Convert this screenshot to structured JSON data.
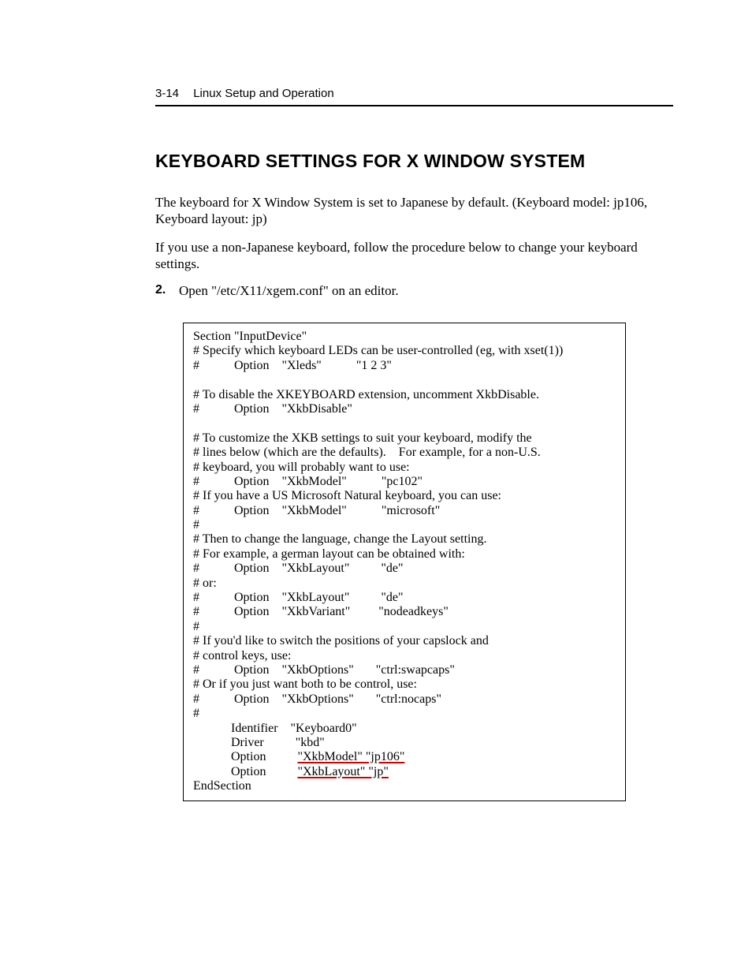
{
  "header": {
    "page_number": "3-14",
    "chapter_title": "Linux Setup and Operation"
  },
  "section_title": "KEYBOARD SETTINGS FOR X WINDOW SYSTEM",
  "paragraphs": {
    "p1": "The keyboard for X Window System is set to Japanese by default. (Keyboard model: jp106, Keyboard layout: jp)",
    "p2": "If you use a non-Japanese keyboard, follow the procedure below to change your keyboard settings."
  },
  "step": {
    "number": "2.",
    "text": "Open \"/etc/X11/xgem.conf\" on an editor."
  },
  "code": {
    "l01": "Section \"InputDevice\"",
    "l02": "# Specify which keyboard LEDs can be user-controlled (eg, with xset(1))",
    "l03": "#           Option    \"Xleds\"           \"1 2 3\"",
    "l04": "",
    "l05": "# To disable the XKEYBOARD extension, uncomment XkbDisable.",
    "l06": "#           Option    \"XkbDisable\"",
    "l07": "",
    "l08": "# To customize the XKB settings to suit your keyboard, modify the",
    "l09": "# lines below (which are the defaults).    For example, for a non-U.S.",
    "l10": "# keyboard, you will probably want to use:",
    "l11": "#           Option    \"XkbModel\"           \"pc102\"",
    "l12": "# If you have a US Microsoft Natural keyboard, you can use:",
    "l13": "#           Option    \"XkbModel\"           \"microsoft\"",
    "l14": "#",
    "l15": "# Then to change the language, change the Layout setting.",
    "l16": "# For example, a german layout can be obtained with:",
    "l17": "#           Option    \"XkbLayout\"          \"de\"",
    "l18": "# or:",
    "l19": "#           Option    \"XkbLayout\"          \"de\"",
    "l20": "#           Option    \"XkbVariant\"         \"nodeadkeys\"",
    "l21": "#",
    "l22": "# If you'd like to switch the positions of your capslock and",
    "l23": "# control keys, use:",
    "l24": "#           Option    \"XkbOptions\"       \"ctrl:swapcaps\"",
    "l25": "# Or if you just want both to be control, use:",
    "l26": "#           Option    \"XkbOptions\"       \"ctrl:nocaps\"",
    "l27": "#",
    "l28": "            Identifier    \"Keyboard0\"",
    "l29": "            Driver          \"kbd\"",
    "l30a": "            Option          ",
    "l30b": "\"XkbModel\" \"jp106\"",
    "l31a": "            Option          ",
    "l31b": "\"XkbLayout\" \"jp\"",
    "l32": "EndSection"
  }
}
